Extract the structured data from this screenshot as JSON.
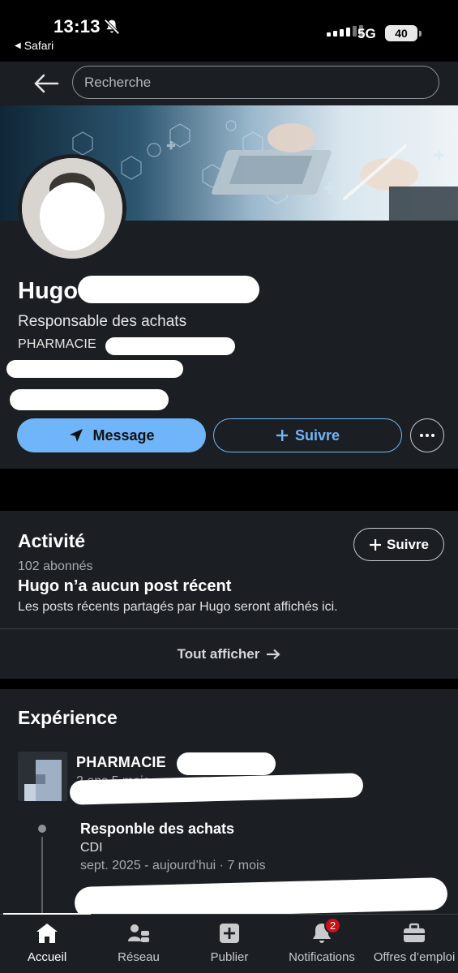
{
  "status_bar": {
    "time": "13:13",
    "back_app": "Safari",
    "network": "5G",
    "battery": "40"
  },
  "search": {
    "placeholder": "Recherche"
  },
  "profile": {
    "name": "Hugo",
    "headline": "Responsable des achats",
    "company": "PHARMACIE",
    "actions": {
      "message": "Message",
      "follow": "Suivre"
    }
  },
  "activity": {
    "title": "Activité",
    "follow": "Suivre",
    "followers": "102 abonnés",
    "no_post_title": "Hugo n’a aucun post récent",
    "no_post_text": "Les posts récents partagés par Hugo seront affichés ici.",
    "show_all": "Tout afficher"
  },
  "experience": {
    "title": "Expérience",
    "company": "PHARMACIE",
    "duration": "2 ans 5 mois",
    "role": "Responble des achats",
    "contract": "CDI",
    "dates": "sept. 2025 - aujourd’hui · 7 mois"
  },
  "bottom_nav": {
    "items": [
      {
        "label": "Accueil",
        "icon": "home-icon"
      },
      {
        "label": "Réseau",
        "icon": "network-icon"
      },
      {
        "label": "Publier",
        "icon": "post-icon"
      },
      {
        "label": "Notifications",
        "icon": "bell-icon",
        "badge": "2"
      },
      {
        "label": "Offres d’emploi",
        "icon": "briefcase-icon"
      }
    ]
  },
  "colors": {
    "background": "#1b1f23",
    "accent": "#70b5f9",
    "badge": "#cc1016"
  }
}
